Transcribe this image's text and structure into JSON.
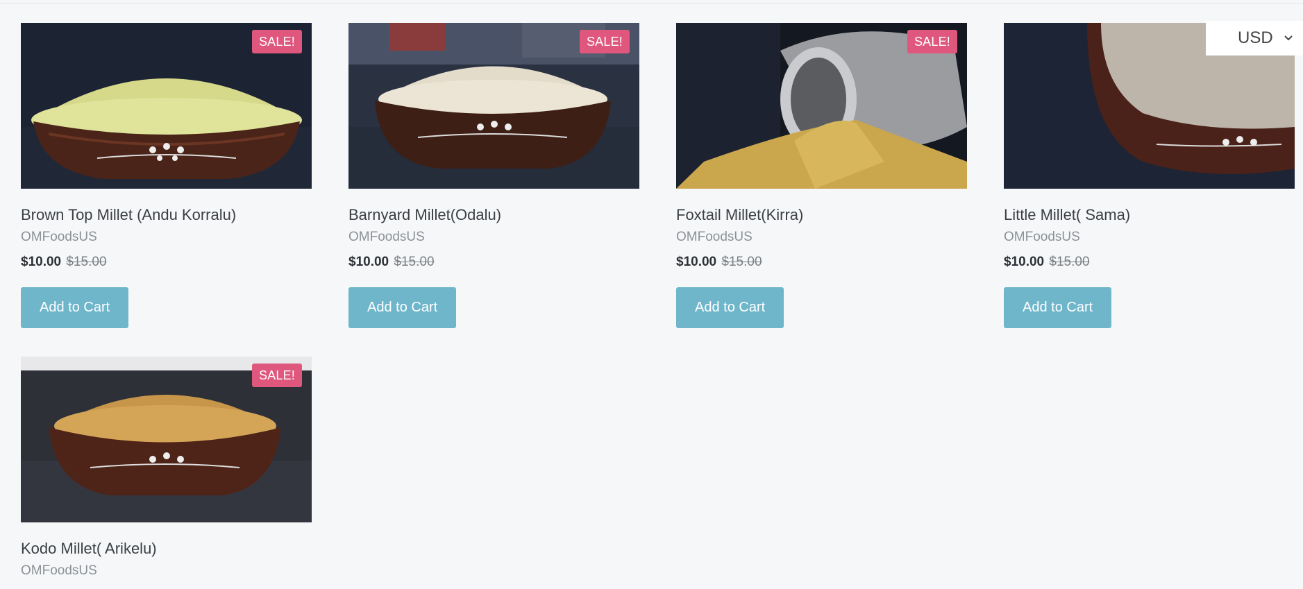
{
  "currency": {
    "selected": "USD"
  },
  "products": [
    {
      "title": "Brown Top Millet (Andu Korralu)",
      "vendor": "OMFoodsUS",
      "price": "$10.00",
      "compare_price": "$15.00",
      "badge": "SALE!",
      "cta": "Add to Cart",
      "image": "bowl-yellow-millet"
    },
    {
      "title": "Barnyard Millet(Odalu)",
      "vendor": "OMFoodsUS",
      "price": "$10.00",
      "compare_price": "$15.00",
      "badge": "SALE!",
      "cta": "Add to Cart",
      "image": "bowl-white-millet"
    },
    {
      "title": "Foxtail Millet(Kirra)",
      "vendor": "OMFoodsUS",
      "price": "$10.00",
      "compare_price": "$15.00",
      "badge": "SALE!",
      "cta": "Add to Cart",
      "image": "silver-pot-spilled-millet"
    },
    {
      "title": "Little Millet( Sama)",
      "vendor": "OMFoodsUS",
      "price": "$10.00",
      "compare_price": "$15.00",
      "badge": "",
      "cta": "Add to Cart",
      "image": "bowl-grey-millet-closeup"
    },
    {
      "title": "Kodo Millet( Arikelu)",
      "vendor": "OMFoodsUS",
      "badge": "SALE!",
      "image": "bowl-golden-millet"
    }
  ],
  "colors": {
    "sale_badge": "#e0577e",
    "button": "#6fb6cb",
    "background": "#f6f7f9"
  }
}
